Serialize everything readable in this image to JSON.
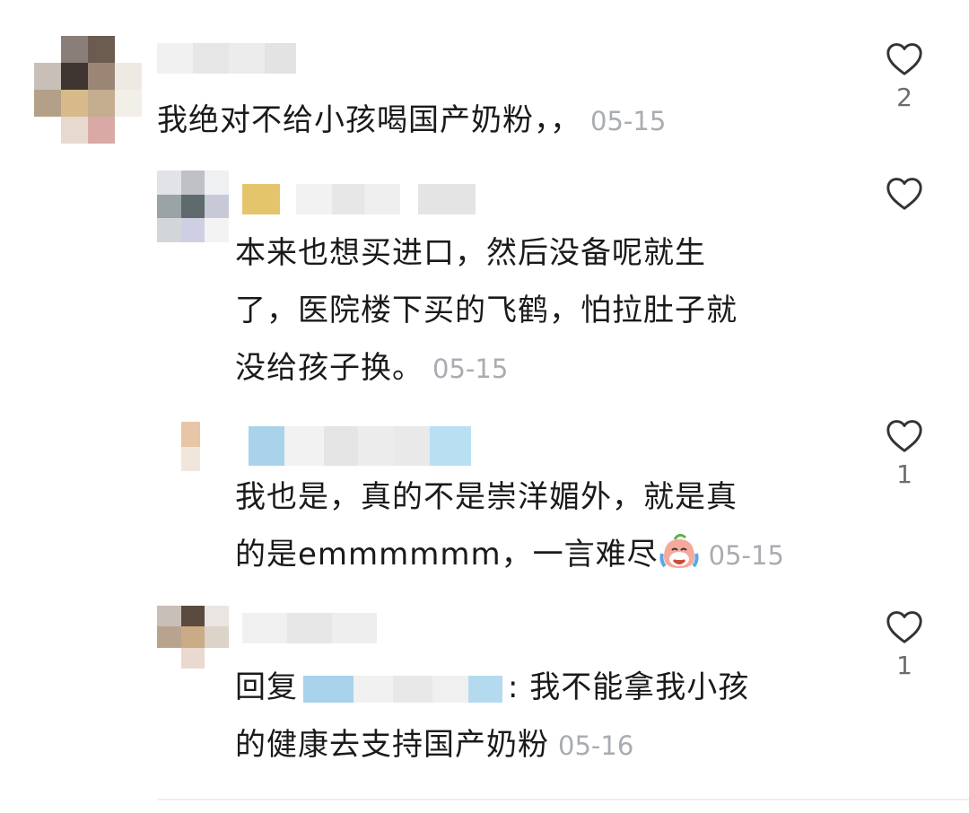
{
  "comments": [
    {
      "text": "我绝对不给小孩喝国产奶粉，，",
      "time": "05-15",
      "likes": "2",
      "icons": {
        "like": "heart-outline-icon"
      }
    },
    {
      "lines": [
        "本来也想买进口，然后没备呢就生",
        "了，医院楼下买的飞鹤，怕拉肚子就",
        "没给孩子换。"
      ],
      "time": "05-15",
      "likes": ""
    },
    {
      "lines": [
        "我也是，真的不是崇洋媚外，就是真",
        "的是emmmmmm，一言难尽"
      ],
      "time": "05-15",
      "likes": "1",
      "icons": {
        "emoji": "crying-emoji-icon"
      }
    },
    {
      "prefix": "回复",
      "after_mention": ": 我不能拿我小孩",
      "line2": "的健康去支持国产奶粉",
      "time": "05-16",
      "likes": "1"
    }
  ],
  "colors": {
    "text": "#1a1a1a",
    "timestamp": "#a9acb1",
    "count": "#6a6d72",
    "heart_stroke": "#333333"
  }
}
